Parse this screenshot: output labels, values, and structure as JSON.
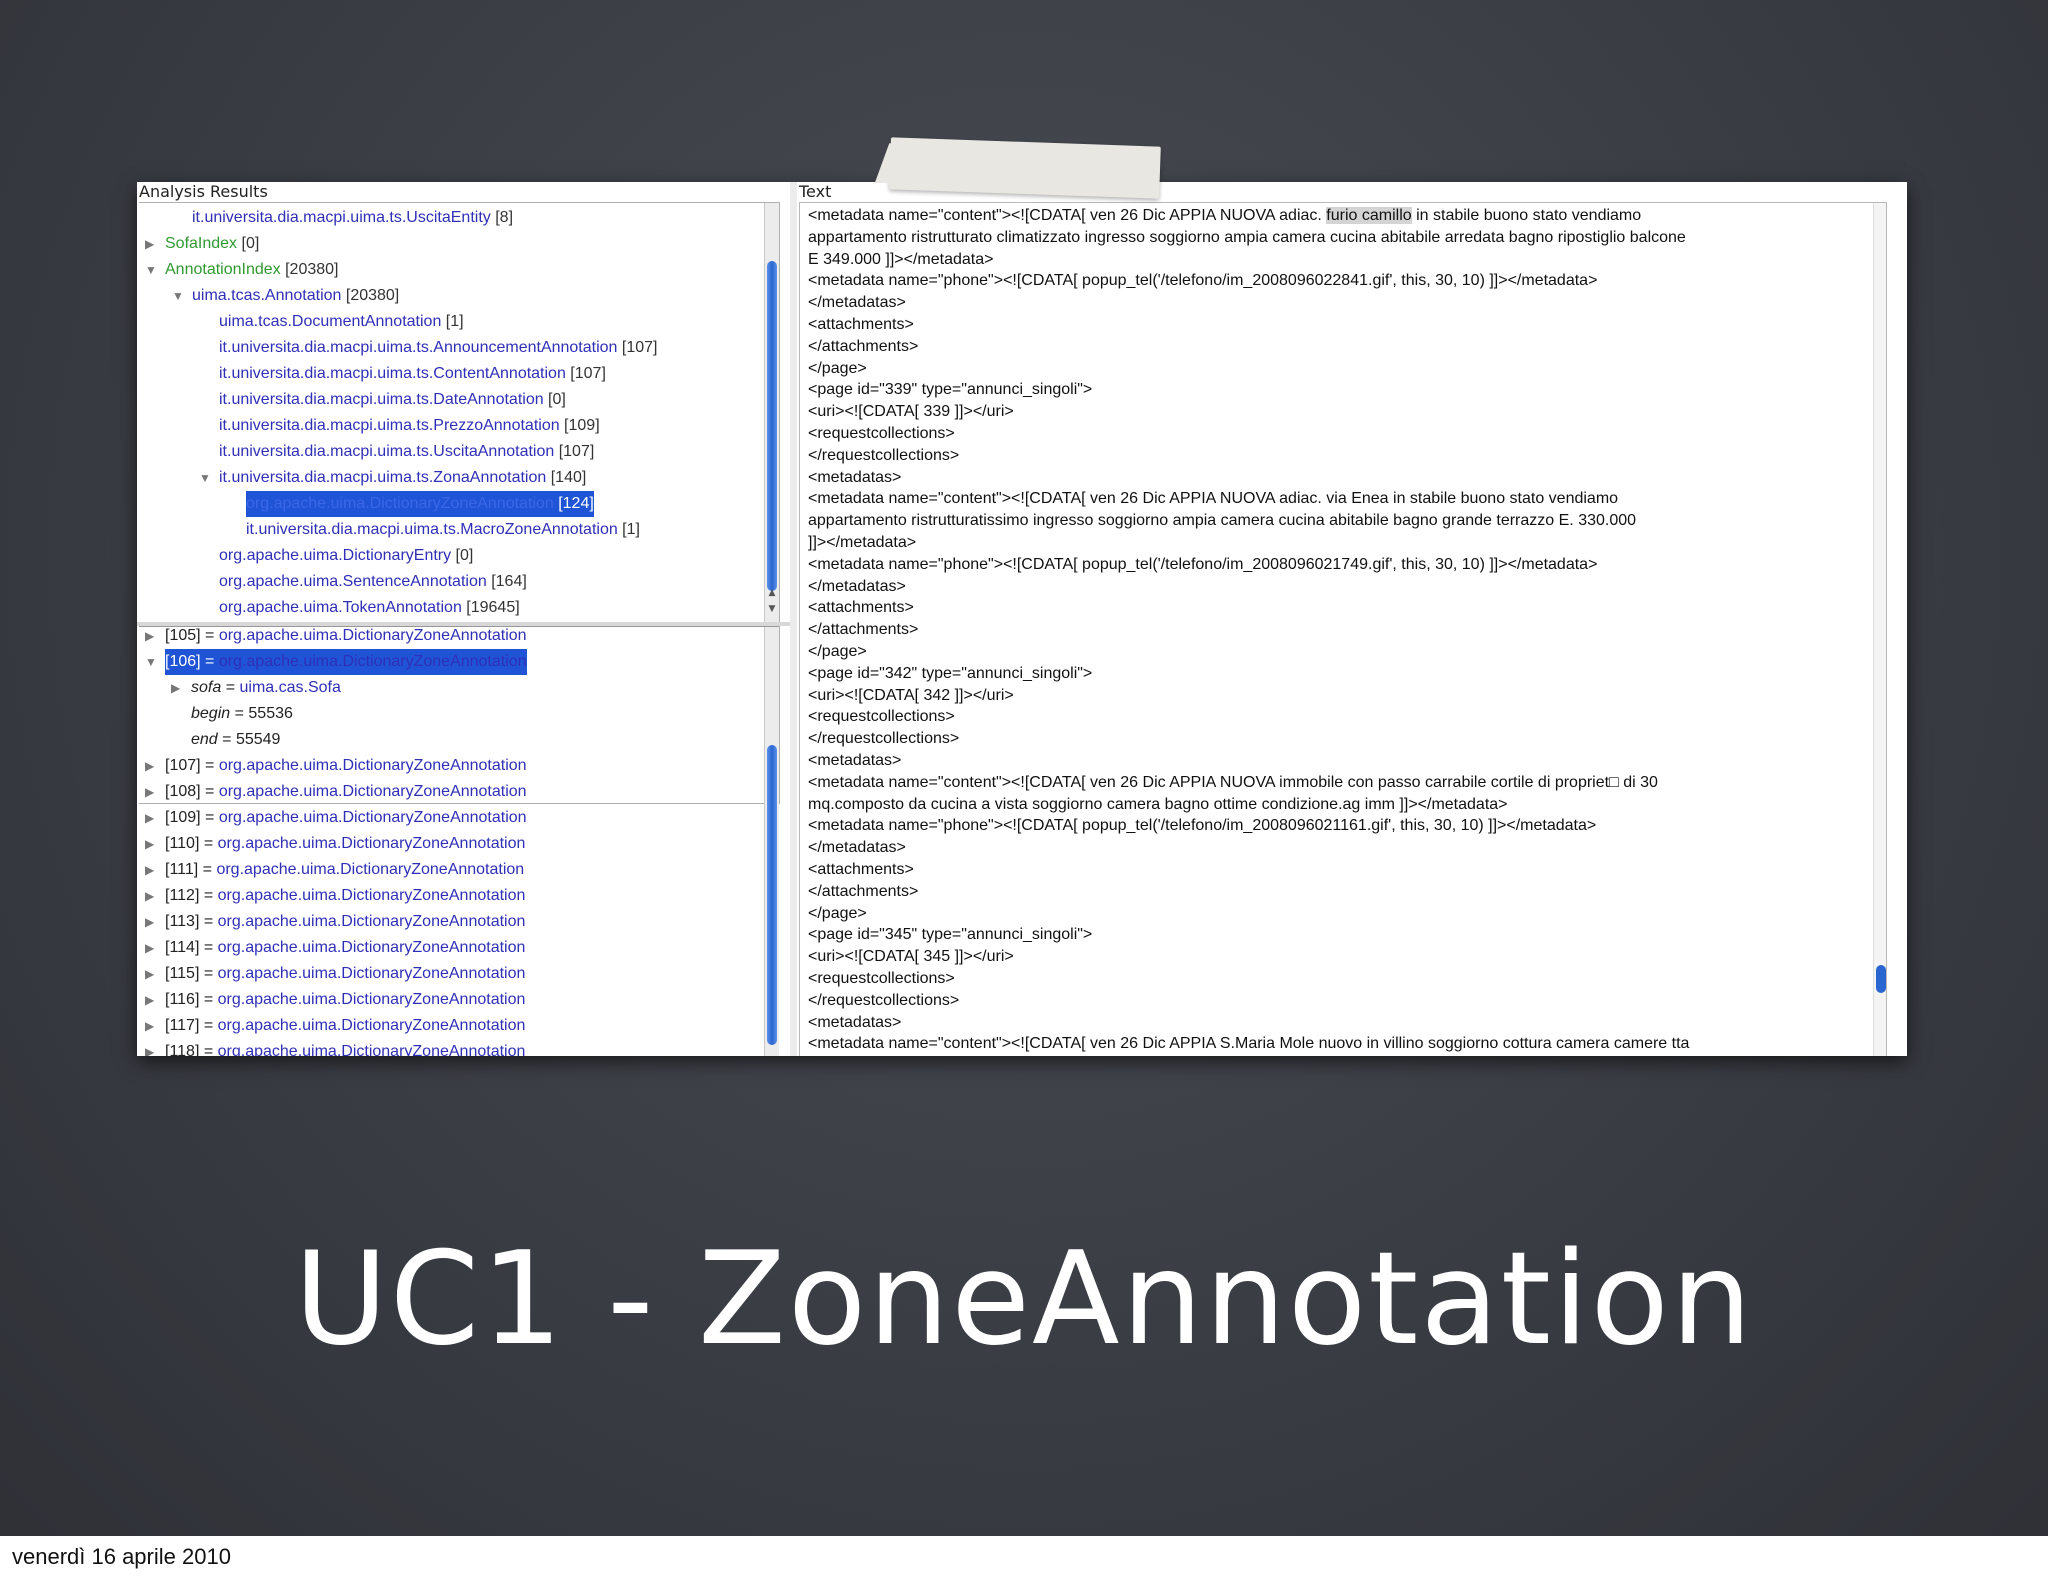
{
  "slide": {
    "title": "UC1 - ZoneAnnotation",
    "footer_date": "venerdì 16 aprile 2010"
  },
  "left_panel": {
    "title": "Analysis Results",
    "tree": [
      {
        "label": "it.universita.dia.macpi.uima.ts.UscitaEntity",
        "count": "[8]",
        "indent": 1,
        "toggle": ""
      },
      {
        "label": "SofaIndex",
        "count": "[0]",
        "indent": 0,
        "toggle": "▶",
        "green": true
      },
      {
        "label": "AnnotationIndex",
        "count": "[20380]",
        "indent": 0,
        "toggle": "▼",
        "green": true
      },
      {
        "label": "uima.tcas.Annotation",
        "count": "[20380]",
        "indent": 1,
        "toggle": "▼"
      },
      {
        "label": "uima.tcas.DocumentAnnotation",
        "count": "[1]",
        "indent": 2,
        "toggle": ""
      },
      {
        "label": "it.universita.dia.macpi.uima.ts.AnnouncementAnnotation",
        "count": "[107]",
        "indent": 2,
        "toggle": ""
      },
      {
        "label": "it.universita.dia.macpi.uima.ts.ContentAnnotation",
        "count": "[107]",
        "indent": 2,
        "toggle": ""
      },
      {
        "label": "it.universita.dia.macpi.uima.ts.DateAnnotation",
        "count": "[0]",
        "indent": 2,
        "toggle": ""
      },
      {
        "label": "it.universita.dia.macpi.uima.ts.PrezzoAnnotation",
        "count": "[109]",
        "indent": 2,
        "toggle": ""
      },
      {
        "label": "it.universita.dia.macpi.uima.ts.UscitaAnnotation",
        "count": "[107]",
        "indent": 2,
        "toggle": ""
      },
      {
        "label": "it.universita.dia.macpi.uima.ts.ZonaAnnotation",
        "count": "[140]",
        "indent": 2,
        "toggle": "▼"
      },
      {
        "label": "org.apache.uima.DictionaryZoneAnnotation",
        "count": "[124]",
        "indent": 3,
        "toggle": "",
        "selected": true
      },
      {
        "label": "it.universita.dia.macpi.uima.ts.MacroZoneAnnotation",
        "count": "[1]",
        "indent": 3,
        "toggle": ""
      },
      {
        "label": "org.apache.uima.DictionaryEntry",
        "count": "[0]",
        "indent": 2,
        "toggle": ""
      },
      {
        "label": "org.apache.uima.SentenceAnnotation",
        "count": "[164]",
        "indent": 2,
        "toggle": ""
      },
      {
        "label": "org.apache.uima.TokenAnnotation",
        "count": "[19645]",
        "indent": 2,
        "toggle": ""
      }
    ],
    "fs_rows": [
      {
        "idx": "[105]",
        "eq": "=",
        "type": "org.apache.uima.DictionaryZoneAnnotation",
        "toggle": "▶"
      },
      {
        "idx": "[106]",
        "eq": "=",
        "type": "org.apache.uima.DictionaryZoneAnnotation",
        "toggle": "▼",
        "selected": true
      },
      {
        "key": "sofa",
        "eq": "=",
        "val": "uima.cas.Sofa",
        "toggle": "▶",
        "indent": 1
      },
      {
        "key": "begin",
        "eq": "=",
        "num": "55536",
        "toggle": "",
        "indent": 1
      },
      {
        "key": "end",
        "eq": "=",
        "num": "55549",
        "toggle": "",
        "indent": 1
      },
      {
        "idx": "[107]",
        "eq": "=",
        "type": "org.apache.uima.DictionaryZoneAnnotation",
        "toggle": "▶"
      },
      {
        "idx": "[108]",
        "eq": "=",
        "type": "org.apache.uima.DictionaryZoneAnnotation",
        "toggle": "▶"
      },
      {
        "idx": "[109]",
        "eq": "=",
        "type": "org.apache.uima.DictionaryZoneAnnotation",
        "toggle": "▶"
      },
      {
        "idx": "[110]",
        "eq": "=",
        "type": "org.apache.uima.DictionaryZoneAnnotation",
        "toggle": "▶"
      },
      {
        "idx": "[111]",
        "eq": "=",
        "type": "org.apache.uima.DictionaryZoneAnnotation",
        "toggle": "▶"
      },
      {
        "idx": "[112]",
        "eq": "=",
        "type": "org.apache.uima.DictionaryZoneAnnotation",
        "toggle": "▶"
      },
      {
        "idx": "[113]",
        "eq": "=",
        "type": "org.apache.uima.DictionaryZoneAnnotation",
        "toggle": "▶"
      },
      {
        "idx": "[114]",
        "eq": "=",
        "type": "org.apache.uima.DictionaryZoneAnnotation",
        "toggle": "▶"
      },
      {
        "idx": "[115]",
        "eq": "=",
        "type": "org.apache.uima.DictionaryZoneAnnotation",
        "toggle": "▶"
      },
      {
        "idx": "[116]",
        "eq": "=",
        "type": "org.apache.uima.DictionaryZoneAnnotation",
        "toggle": "▶"
      },
      {
        "idx": "[117]",
        "eq": "=",
        "type": "org.apache.uima.DictionaryZoneAnnotation",
        "toggle": "▶"
      },
      {
        "idx": "[118]",
        "eq": "=",
        "type": "org.apache.uima.DictionaryZoneAnnotation",
        "toggle": "▶"
      }
    ]
  },
  "right_panel": {
    "title": "Text",
    "lines": [
      {
        "pre": "<metadata name=\"content\"><![CDATA[ ven 26 Dic APPIA NUOVA adiac. ",
        "hl": "furio camillo",
        "post": " in stabile buono stato vendiamo"
      },
      {
        "pre": "appartamento ristrutturato climatizzato ingresso soggiorno ampia camera cucina abitabile arredata bagno ripostiglio balcone"
      },
      {
        "pre": "E 349.000 ]]></metadata>"
      },
      {
        "pre": "<metadata name=\"phone\"><![CDATA[ popup_tel('/telefono/im_2008096022841.gif', this, 30, 10) ]]></metadata>"
      },
      {
        "pre": "</metadatas>"
      },
      {
        "pre": "<attachments>"
      },
      {
        "pre": "</attachments>"
      },
      {
        "pre": "</page>"
      },
      {
        "pre": "<page id=\"339\" type=\"annunci_singoli\">"
      },
      {
        "pre": "<uri><![CDATA[ 339 ]]></uri>"
      },
      {
        "pre": "<requestcollections>"
      },
      {
        "pre": "</requestcollections>"
      },
      {
        "pre": "<metadatas>"
      },
      {
        "pre": "<metadata name=\"content\"><![CDATA[ ven 26 Dic APPIA NUOVA adiac. via Enea in stabile buono stato vendiamo"
      },
      {
        "pre": "appartamento ristrutturatissimo ingresso soggiorno ampia camera cucina abitabile bagno grande terrazzo E. 330.000"
      },
      {
        "pre": "]]></metadata>"
      },
      {
        "pre": "<metadata name=\"phone\"><![CDATA[ popup_tel('/telefono/im_2008096021749.gif', this, 30, 10) ]]></metadata>"
      },
      {
        "pre": "</metadatas>"
      },
      {
        "pre": "<attachments>"
      },
      {
        "pre": "</attachments>"
      },
      {
        "pre": "</page>"
      },
      {
        "pre": "<page id=\"342\" type=\"annunci_singoli\">"
      },
      {
        "pre": "<uri><![CDATA[ 342 ]]></uri>"
      },
      {
        "pre": "<requestcollections>"
      },
      {
        "pre": "</requestcollections>"
      },
      {
        "pre": "<metadatas>"
      },
      {
        "pre": "<metadata name=\"content\"><![CDATA[ ven 26 Dic APPIA NUOVA immobile con passo carrabile cortile di propriet□ di 30"
      },
      {
        "pre": "mq.composto da cucina a vista soggiorno camera bagno ottime condizione.ag imm ]]></metadata>"
      },
      {
        "pre": "<metadata name=\"phone\"><![CDATA[ popup_tel('/telefono/im_2008096021161.gif', this, 30, 10) ]]></metadata>"
      },
      {
        "pre": "</metadatas>"
      },
      {
        "pre": "<attachments>"
      },
      {
        "pre": "</attachments>"
      },
      {
        "pre": "</page>"
      },
      {
        "pre": "<page id=\"345\" type=\"annunci_singoli\">"
      },
      {
        "pre": "<uri><![CDATA[ 345 ]]></uri>"
      },
      {
        "pre": "<requestcollections>"
      },
      {
        "pre": "</requestcollections>"
      },
      {
        "pre": "<metadatas>"
      },
      {
        "pre": "<metadata name=\"content\"><![CDATA[ ven 26 Dic APPIA S.Maria Mole nuovo in villino soggiorno cottura camera camere tta"
      }
    ]
  }
}
